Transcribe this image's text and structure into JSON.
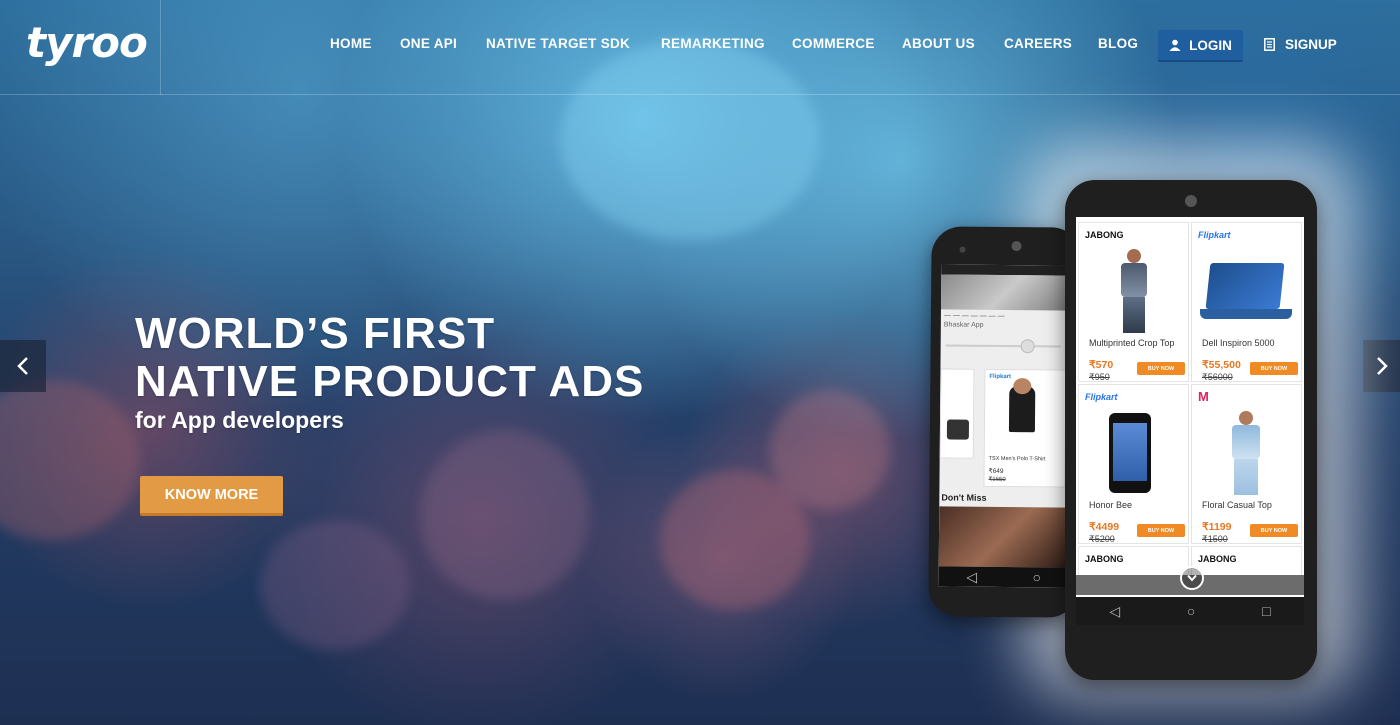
{
  "header": {
    "logo_text": "tyroo",
    "nav": [
      "HOME",
      "ONE API",
      "NATIVE TARGET SDK",
      "REMARKETING",
      "COMMERCE",
      "ABOUT US",
      "CAREERS",
      "BLOG"
    ],
    "login_label": "LOGIN",
    "signup_label": "SIGNUP"
  },
  "hero": {
    "headline_line1": "WORLD’S FIRST",
    "headline_line2": "NATIVE PRODUCT ADS",
    "subline": "for App developers",
    "cta_label": "KNOW MORE"
  },
  "slider": {
    "prev_icon": "chevron-left-icon",
    "next_icon": "chevron-right-icon"
  },
  "front_phone": {
    "products": [
      {
        "brand": "JABONG",
        "name": "Multiprinted Crop Top",
        "price": "₹570",
        "old_price": "₹950",
        "cta": "BUY NOW"
      },
      {
        "brand": "Flipkart",
        "name": "Dell Inspiron 5000",
        "price": "₹55,500",
        "old_price": "₹56000",
        "cta": "BUY NOW"
      },
      {
        "brand": "Flipkart",
        "name": "Honor Bee",
        "price": "₹4499",
        "old_price": "₹5200",
        "cta": "BUY NOW"
      },
      {
        "brand": "M",
        "name": "Floral Casual Top",
        "price": "₹1199",
        "old_price": "₹1500",
        "cta": "BUY NOW"
      }
    ],
    "next_brands": [
      "JABONG",
      "JABONG"
    ]
  },
  "back_phone": {
    "app_label": "Bhaskar App",
    "product_name": "TSX Men's Polo T-Shirt",
    "price": "₹649",
    "old_price": "₹1650",
    "brand": "Flipkart",
    "section": "Don't Miss"
  },
  "colors": {
    "login_bg": "#1f5f9f",
    "cta_bg": "#e39a45",
    "price": "#e87722"
  }
}
